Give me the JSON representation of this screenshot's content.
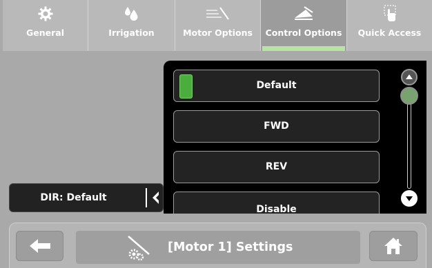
{
  "tabs": [
    {
      "label": "General",
      "icon": "gear-icon",
      "active": false
    },
    {
      "label": "Irrigation",
      "icon": "water-drops-icon",
      "active": false
    },
    {
      "label": "Motor Options",
      "icon": "motor-options-icon",
      "active": false
    },
    {
      "label": "Control Options",
      "icon": "control-options-icon",
      "active": true
    },
    {
      "label": "Quick Access",
      "icon": "hand-tap-icon",
      "active": false
    }
  ],
  "dir_control": {
    "label": "DIR: Default",
    "icon": "chevron-left-icon"
  },
  "options": [
    {
      "label": "Default",
      "selected": true
    },
    {
      "label": "FWD",
      "selected": false
    },
    {
      "label": "REV",
      "selected": false
    },
    {
      "label": "Disable",
      "selected": false
    }
  ],
  "scroll": {
    "up_icon": "chevron-up-icon",
    "down_icon": "chevron-down-icon"
  },
  "footer": {
    "back_icon": "arrow-left-icon",
    "title_icon": "motor-settings-icon",
    "title": "[Motor 1] Settings",
    "home_icon": "home-icon"
  },
  "colors": {
    "selected_lamp": "#4aad3e",
    "active_tab_indicator": "#b9e2a5",
    "panel_bg": "#000000"
  }
}
